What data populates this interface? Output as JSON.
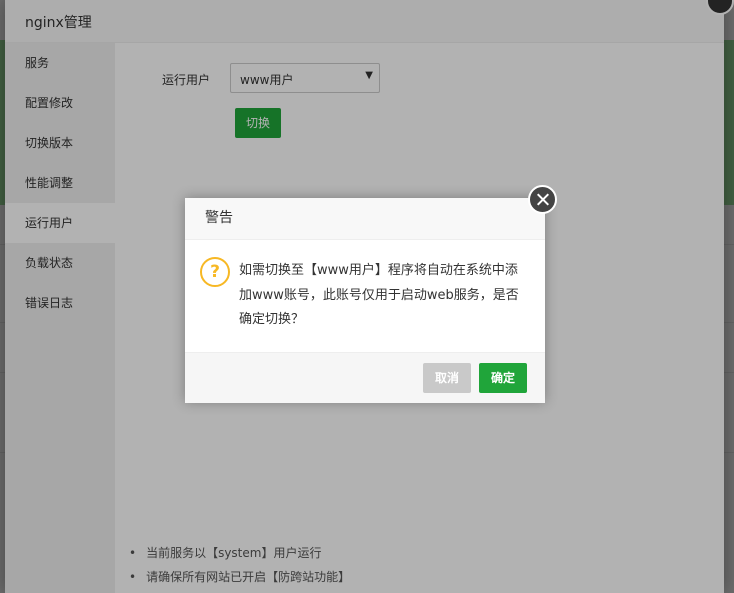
{
  "layer": {
    "title": "nginx管理",
    "sidebar": [
      {
        "label": "服务"
      },
      {
        "label": "配置修改"
      },
      {
        "label": "切换版本"
      },
      {
        "label": "性能调整"
      },
      {
        "label": "运行用户"
      },
      {
        "label": "负载状态"
      },
      {
        "label": "错误日志"
      }
    ],
    "active_item": "运行用户",
    "run_user_label": "运行用户",
    "run_user_select": "www用户",
    "switch_button": "切换",
    "tips": [
      "当前服务以【system】用户运行",
      "请确保所有网站已开启【防跨站功能】"
    ]
  },
  "dialog": {
    "title": "警告",
    "message": "如需切换至【www用户】程序将自动在系统中添加www账号，此账号仅用于启动web服务，是否确定切换？",
    "cancel_label": "取消",
    "ok_label": "确定"
  },
  "colors": {
    "primary_green": "#20a53a",
    "warning_icon": "#f7b824",
    "cancel_gray": "#c9c9c9"
  },
  "icons": {
    "layer_close": "close-icon",
    "dialog_close": "close-icon",
    "dialog_question": "question-icon",
    "select_arrow": "caret-down-icon"
  }
}
